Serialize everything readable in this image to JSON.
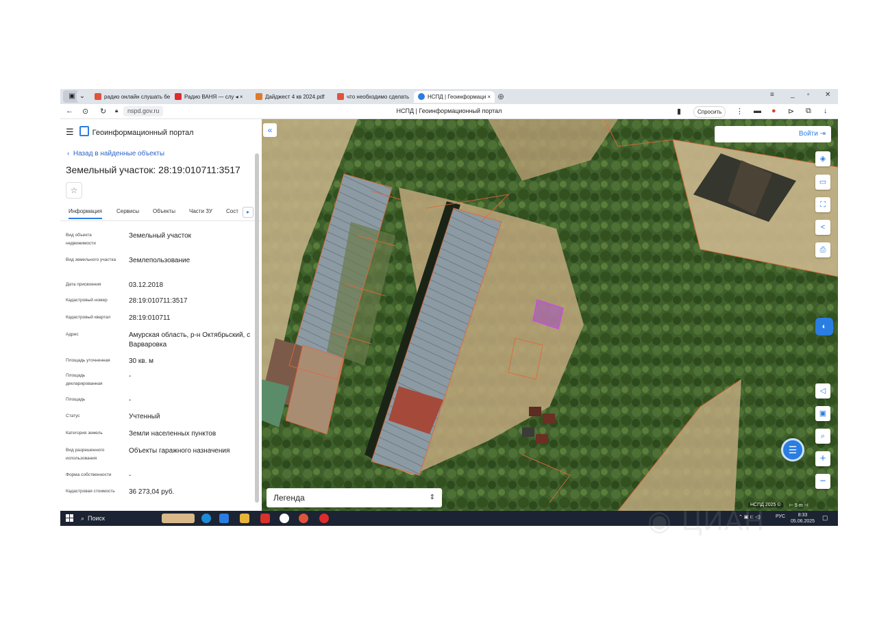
{
  "browser": {
    "tabs": [
      {
        "label": "радио онлайн слушать бе",
        "color": "#e0533c"
      },
      {
        "label": "Радио ВАНЯ — слу",
        "color": "#e02b2b"
      },
      {
        "label": "Дайджест 4 кв 2024.pdf",
        "color": "#e07a2b"
      },
      {
        "label": "что необходимо сделать",
        "color": "#e0533c"
      },
      {
        "label": "НСПД | Геоинформаци",
        "color": "#2a7de1"
      }
    ],
    "url": "nspd.gov.ru",
    "page_title": "НСПД | Геоинформационный портал",
    "ask_button": "Спросить"
  },
  "panel": {
    "portal_name": "Геоинформационный портал",
    "back_link": "Назад в найденные объекты",
    "title": "Земельный участок: 28:19:010711:3517",
    "tabs": [
      "Информация",
      "Сервисы",
      "Объекты",
      "Части ЗУ",
      "Сост"
    ],
    "fields": [
      {
        "key": "Вид объекта недвижимости",
        "value": "Земельный участок"
      },
      {
        "key": "Вид земельного участка",
        "value": "Землепользование"
      },
      {
        "key": "Дата присвоения",
        "value": "03.12.2018"
      },
      {
        "key": "Кадастровый номер",
        "value": "28:19:010711:3517"
      },
      {
        "key": "Кадастровый квартал",
        "value": "28:19:010711"
      },
      {
        "key": "Адрес",
        "value": "Амурская область, р-н Октябрьский, с Варваровка"
      },
      {
        "key": "Площадь уточненная",
        "value": "30 кв. м"
      },
      {
        "key": "Площадь декларированная",
        "value": "-"
      },
      {
        "key": "Площадь",
        "value": "-"
      },
      {
        "key": "Статус",
        "value": "Учтенный"
      },
      {
        "key": "Категория земель",
        "value": "Земли населенных пунктов"
      },
      {
        "key": "Вид разрешенного использования",
        "value": "Объекты гаражного назначения"
      },
      {
        "key": "Форма собственности",
        "value": "-"
      },
      {
        "key": "Кадастровая стоимость",
        "value": "36 273,04 руб."
      }
    ]
  },
  "map": {
    "login_label": "Войти",
    "legend_label": "Легенда",
    "attribution": "НСПД 2025 ©",
    "scale_label": "5 m"
  },
  "taskbar": {
    "search_label": "Поиск",
    "lang": "РУС",
    "time": "8:33",
    "date": "05.06.2025"
  },
  "watermark": "ЦИАН"
}
